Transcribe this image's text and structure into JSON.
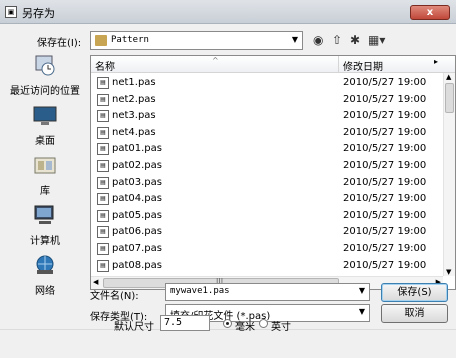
{
  "window": {
    "title": "另存为",
    "close_label": "x"
  },
  "toolbar": {
    "save_in_label": "保存在(I):",
    "location": "Pattern"
  },
  "places": [
    {
      "label": "最近访问的位置",
      "icon": "recent-places-icon"
    },
    {
      "label": "桌面",
      "icon": "desktop-icon"
    },
    {
      "label": "库",
      "icon": "library-icon"
    },
    {
      "label": "计算机",
      "icon": "computer-icon"
    },
    {
      "label": "网络",
      "icon": "network-icon"
    }
  ],
  "filelist": {
    "columns": {
      "name": "名称",
      "date": "修改日期"
    },
    "files": [
      {
        "name": "net1.pas",
        "date": "2010/5/27 19:00"
      },
      {
        "name": "net2.pas",
        "date": "2010/5/27 19:00"
      },
      {
        "name": "net3.pas",
        "date": "2010/5/27 19:00"
      },
      {
        "name": "net4.pas",
        "date": "2010/5/27 19:00"
      },
      {
        "name": "pat01.pas",
        "date": "2010/5/27 19:00"
      },
      {
        "name": "pat02.pas",
        "date": "2010/5/27 19:00"
      },
      {
        "name": "pat03.pas",
        "date": "2010/5/27 19:00"
      },
      {
        "name": "pat04.pas",
        "date": "2010/5/27 19:00"
      },
      {
        "name": "pat05.pas",
        "date": "2010/5/27 19:00"
      },
      {
        "name": "pat06.pas",
        "date": "2010/5/27 19:00"
      },
      {
        "name": "pat07.pas",
        "date": "2010/5/27 19:00"
      },
      {
        "name": "pat08.pas",
        "date": "2010/5/27 19:00"
      }
    ],
    "hscroll_grip": "III"
  },
  "form": {
    "filename_label": "文件名(N):",
    "filename_value": "mywave1.pas",
    "filetype_label": "保存类型(T):",
    "filetype_value": "填充/印花文件 (*.pas)",
    "save_button": "保存(S)",
    "cancel_button": "取消"
  },
  "options": {
    "default_size_label": "默认尺寸",
    "default_size_value": "7.5",
    "unit_mm": "毫米",
    "unit_inch": "英寸",
    "selected_unit": "毫米"
  }
}
